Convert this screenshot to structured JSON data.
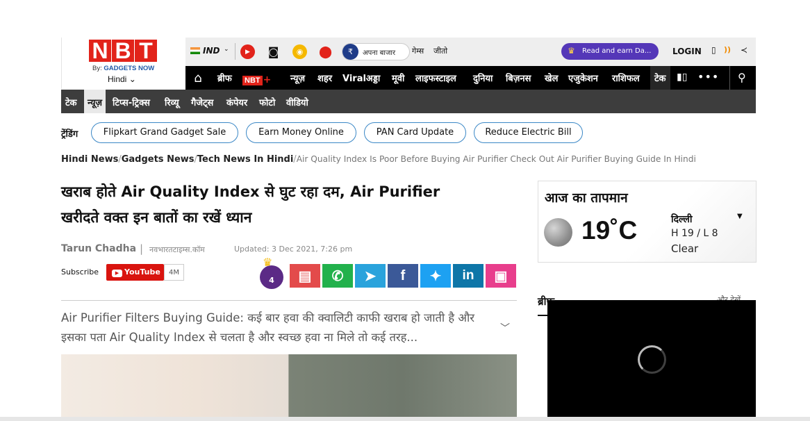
{
  "logo": {
    "letters": [
      "N",
      "B",
      "T"
    ],
    "by_prefix": "By:",
    "by_brand": "GADGETS NOW",
    "language": "Hindi",
    "language_chevron": "⌄"
  },
  "utility": {
    "region": "IND",
    "region_chevron": "⌄",
    "bazaar_label": "अपना बाजार",
    "games": "गेम्स",
    "jeeto": "जीतो",
    "read_earn": "Read and earn Da...",
    "login": "LOGIN"
  },
  "main_nav": {
    "items": [
      "ब्रीफ",
      "न्यूज़",
      "शहर",
      "Viralअड्डा",
      "मूवी",
      "लाइफस्टाइल",
      "दुनिया",
      "बिज़नस",
      "खेल",
      "एजुकेशन",
      "राशिफल",
      "टेक"
    ],
    "nbt_plus": "NBT",
    "active": "टेक"
  },
  "sub_nav": {
    "items": [
      "टेक",
      "न्यूज़",
      "टिप्स-ट्रिक्स",
      "रिव्यू",
      "गैजेट्स",
      "कंपेयर",
      "फोटो",
      "वीडियो"
    ],
    "active": "न्यूज़"
  },
  "trending": {
    "label": "ट्रेंडिंग",
    "pills": [
      "Flipkart Grand Gadget Sale",
      "Earn Money Online",
      "PAN Card Update",
      "Reduce Electric Bill"
    ]
  },
  "breadcrumb": {
    "links": [
      "Hindi News",
      "Gadgets News",
      "Tech News In Hindi"
    ],
    "current": "Air Quality Index Is Poor Before Buying Air Purifier Check Out Air Purifier Buying Guide In Hindi"
  },
  "article": {
    "headline_line1": "खराब होते Air Quality Index से घुट रहा दम, Air Purifier",
    "headline_line2": "खरीदते वक्त इन बातों का रखें ध्यान",
    "author": "Tarun Chadha",
    "separator": "|",
    "source": "नवभारतटाइम्स.कॉम",
    "updated": "Updated: 3 Dec 2021, 7:26 pm",
    "subscribe": "Subscribe",
    "youtube_label": "YouTube",
    "youtube_count": "4M",
    "badge_count": "4",
    "summary": "Air Purifier Filters Buying Guide: कई बार हवा की क्वालिटी काफी खराब हो जाती है और इसका पता Air Quality Index से चलता है और स्वच्छ हवा ना मिले तो कई तरह..."
  },
  "share_buttons": [
    {
      "name": "comment",
      "glyph": "▤",
      "color": "#e34b4b"
    },
    {
      "name": "whatsapp",
      "glyph": "✆",
      "color": "#22b14c"
    },
    {
      "name": "telegram",
      "glyph": "➤",
      "color": "#2aa3dc"
    },
    {
      "name": "facebook",
      "glyph": "f",
      "color": "#3b5998"
    },
    {
      "name": "twitter",
      "glyph": "✦",
      "color": "#1da1f2"
    },
    {
      "name": "linkedin",
      "glyph": "in",
      "color": "#0e76a8"
    },
    {
      "name": "shop",
      "glyph": "▣",
      "color": "#e83e8c"
    }
  ],
  "weather": {
    "title": "आज का तापमान",
    "temp": "19˚C",
    "city": "दिल्ली",
    "high_low": "H 19 / L 8",
    "condition": "Clear"
  },
  "sidebar": {
    "brief_label": "ब्रीफ",
    "more": "और देखें"
  },
  "colors": {
    "brand_red": "#e2231a",
    "nav_black": "#000000",
    "subnav_gray": "#3d3d3d",
    "pill_border": "#3a87c6",
    "read_earn_purple": "#5437b8"
  }
}
